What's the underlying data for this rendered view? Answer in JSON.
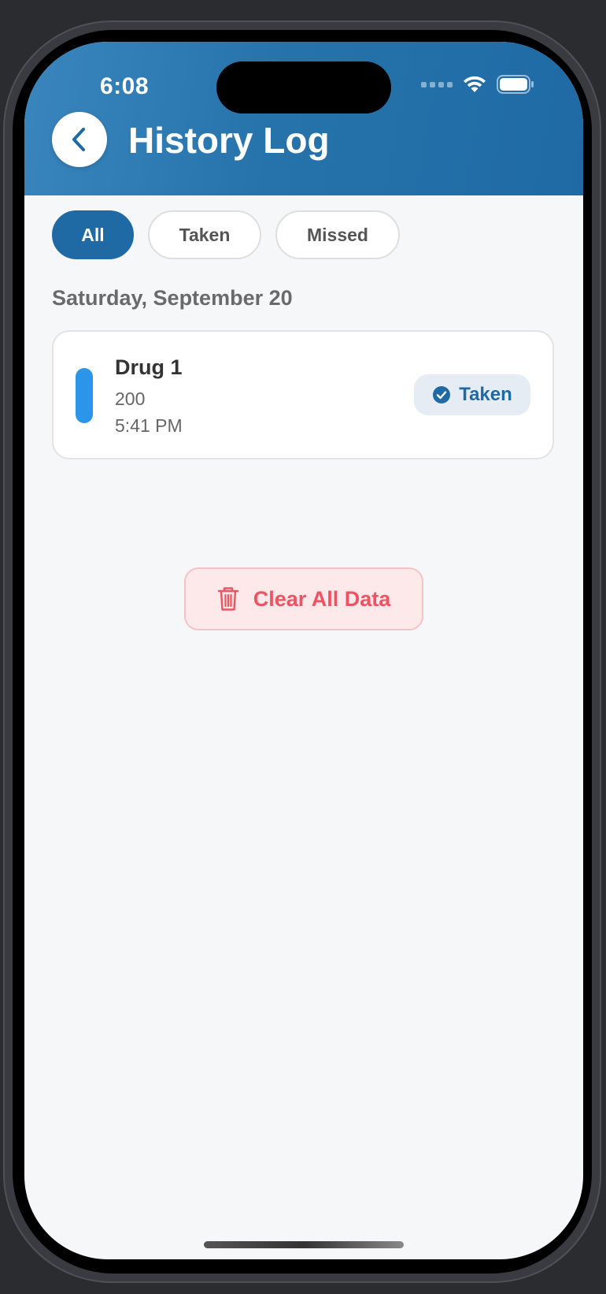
{
  "status_bar": {
    "time": "6:08"
  },
  "header": {
    "title": "History Log"
  },
  "filters": [
    {
      "label": "All",
      "active": true
    },
    {
      "label": "Taken",
      "active": false
    },
    {
      "label": "Missed",
      "active": false
    }
  ],
  "log": {
    "date_heading": "Saturday, September 20",
    "entries": [
      {
        "name": "Drug 1",
        "dose": "200",
        "time": "5:41 PM",
        "status": "Taken"
      }
    ]
  },
  "actions": {
    "clear_label": "Clear All Data"
  },
  "colors": {
    "primary": "#1f6aa5",
    "pill": "#2b95ea",
    "danger": "#ef5361",
    "danger_bg": "#fde8ea"
  }
}
